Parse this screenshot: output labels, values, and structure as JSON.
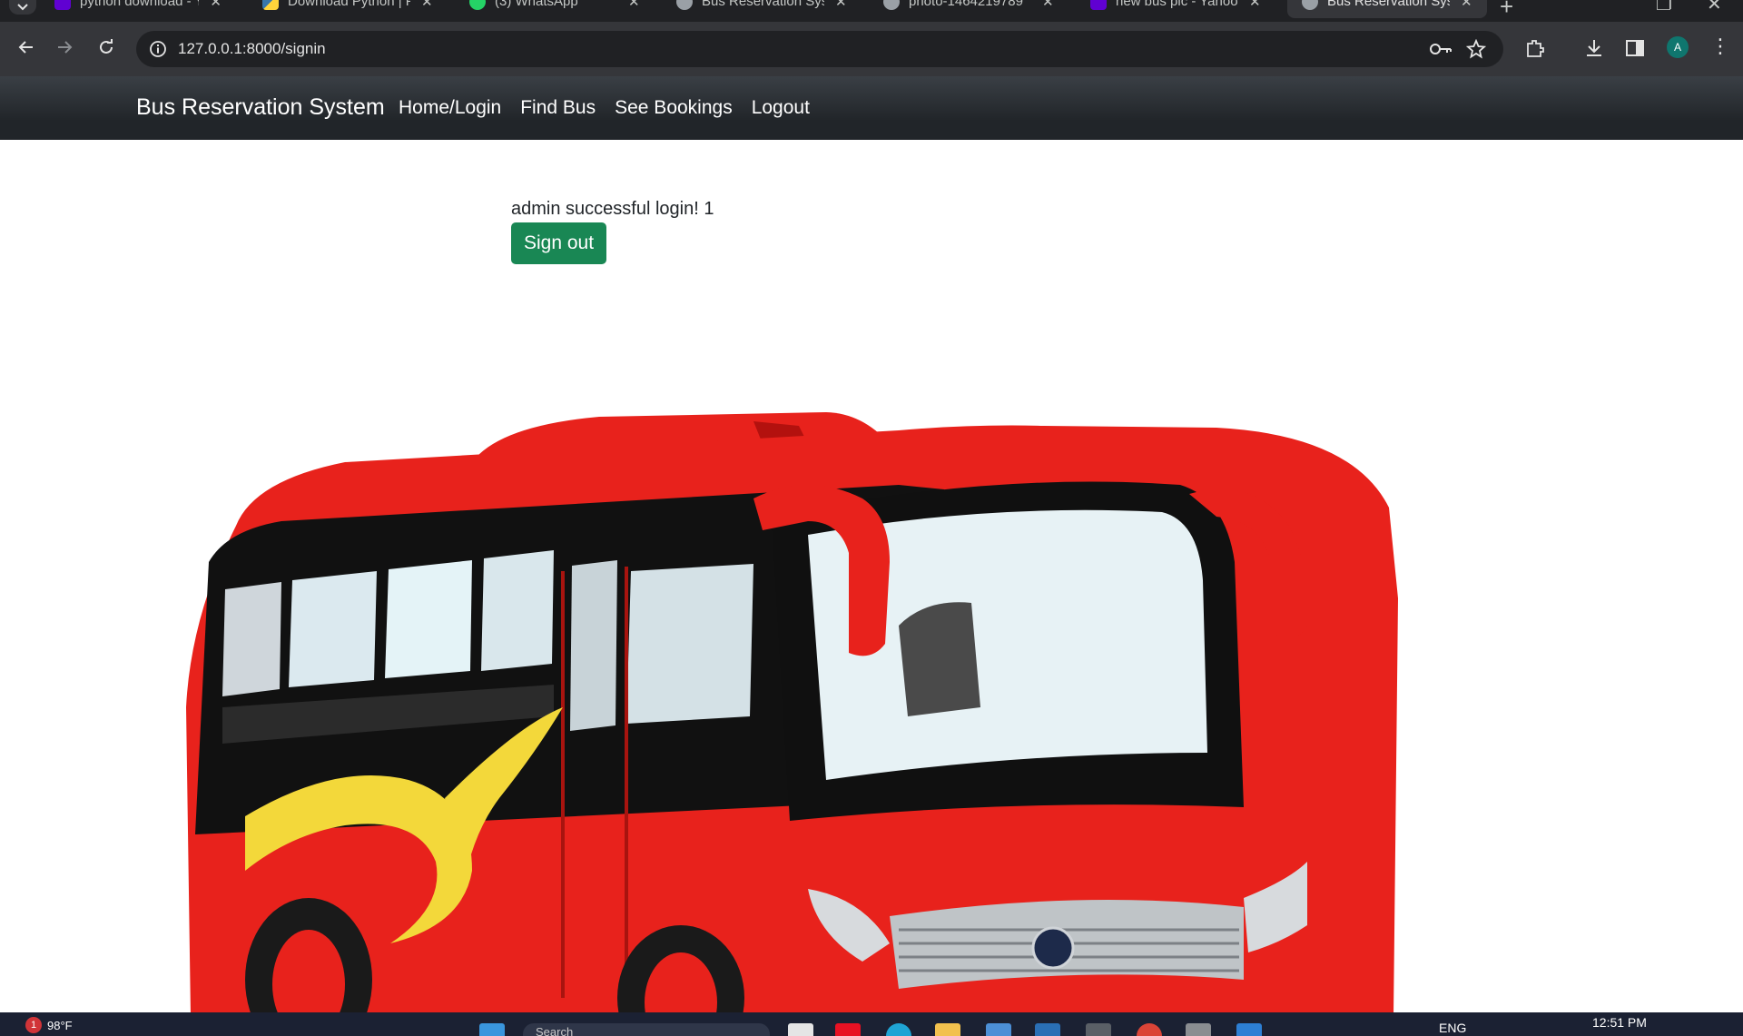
{
  "browser": {
    "tabs": [
      {
        "title": "python download - Y",
        "favicon_color": "#6001d2",
        "favicon": "yahoo-icon"
      },
      {
        "title": "Download Python | P",
        "favicon_color": "#3776ab",
        "favicon": "python-icon"
      },
      {
        "title": "(3) WhatsApp",
        "favicon_color": "#25d366",
        "favicon": "whatsapp-icon"
      },
      {
        "title": "Bus Reservation Syst",
        "favicon_color": "#9aa0a6",
        "favicon": "globe-icon"
      },
      {
        "title": "photo-1464219789",
        "favicon_color": "#9aa0a6",
        "favicon": "globe-icon"
      },
      {
        "title": "new bus pic - Yahoo",
        "favicon_color": "#6001d2",
        "favicon": "yahoo-icon"
      },
      {
        "title": "Bus Reservation Syst",
        "favicon_color": "#9aa0a6",
        "favicon": "globe-icon",
        "active": true
      }
    ],
    "url": "127.0.0.1:8000/signin",
    "profile_initial": "A"
  },
  "site": {
    "brand": "Bus Reservation System",
    "nav": [
      "Home/Login",
      "Find Bus",
      "See Bookings",
      "Logout"
    ]
  },
  "main": {
    "message": "admin successful login! 1",
    "signout_label": "Sign out",
    "signout_color": "#198754",
    "bus_color": "#e8221c"
  },
  "taskbar": {
    "weather_badge": "1",
    "temperature": "98°F",
    "search_placeholder": "Search",
    "language": "ENG",
    "time": "12:51 PM"
  }
}
